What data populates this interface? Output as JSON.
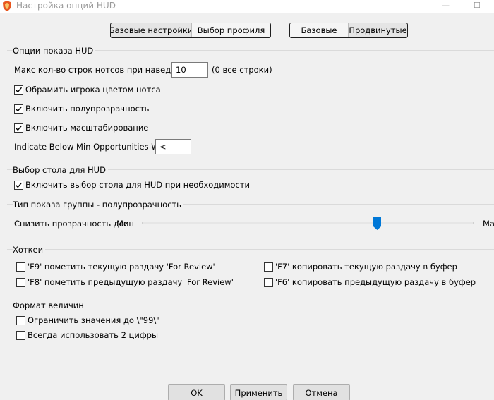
{
  "window": {
    "title": "Настройка опций HUD",
    "minimize_glyph": "—",
    "maximize_glyph": "☐"
  },
  "top_tabs": {
    "left": [
      "Базовые настройки",
      "Выбор профиля"
    ],
    "right": [
      "Базовые",
      "Продвинутые"
    ]
  },
  "hud_options": {
    "title": "Опции показа HUD",
    "max_rows_label": "Макс кол-во строк нотсов при наведении:",
    "max_rows_value": "10",
    "max_rows_hint": "(0 все строки)",
    "checkboxes": [
      {
        "label": "Обрамить игрока цветом нотса",
        "checked": true
      },
      {
        "label": "Включить полупрозрачность",
        "checked": true
      },
      {
        "label": "Включить масштабирование",
        "checked": true
      }
    ],
    "indicate_label": "Indicate Below Min Opportunities With:",
    "indicate_value": "<"
  },
  "table_select": {
    "title": "Выбор стола для HUD",
    "checkbox_label": "Включить выбор стола для HUD при необходимости",
    "checked": true
  },
  "group_transparency": {
    "title": "Тип показа группы - полупрозрачность",
    "label": "Снизить прозрачность до:",
    "min_label": "Мин",
    "max_label": "Ма",
    "level": 0.71
  },
  "hotkeys": {
    "title": "Хоткеи",
    "items": [
      {
        "label": "'F9' пометить текущую раздачу 'For Review'",
        "checked": false
      },
      {
        "label": "'F7' копировать текущую раздачу в буфер",
        "checked": false
      },
      {
        "label": "'F8' пометить предыдущую раздачу 'For Review'",
        "checked": false
      },
      {
        "label": "'F6' копировать предыдущую раздачу в буфер",
        "checked": false
      }
    ]
  },
  "value_format": {
    "title": "Формат величин",
    "items": [
      {
        "label": "Ограничить значения до \\\"99\\\"",
        "checked": false
      },
      {
        "label": "Всегда использовать 2 цифры",
        "checked": false
      }
    ]
  },
  "footer": {
    "ok": "OK",
    "apply": "Применить",
    "cancel": "Отмена"
  },
  "colors": {
    "background": "#f0f0f0",
    "slider_thumb": "#0078d7",
    "app_icon": "#e8561e"
  }
}
